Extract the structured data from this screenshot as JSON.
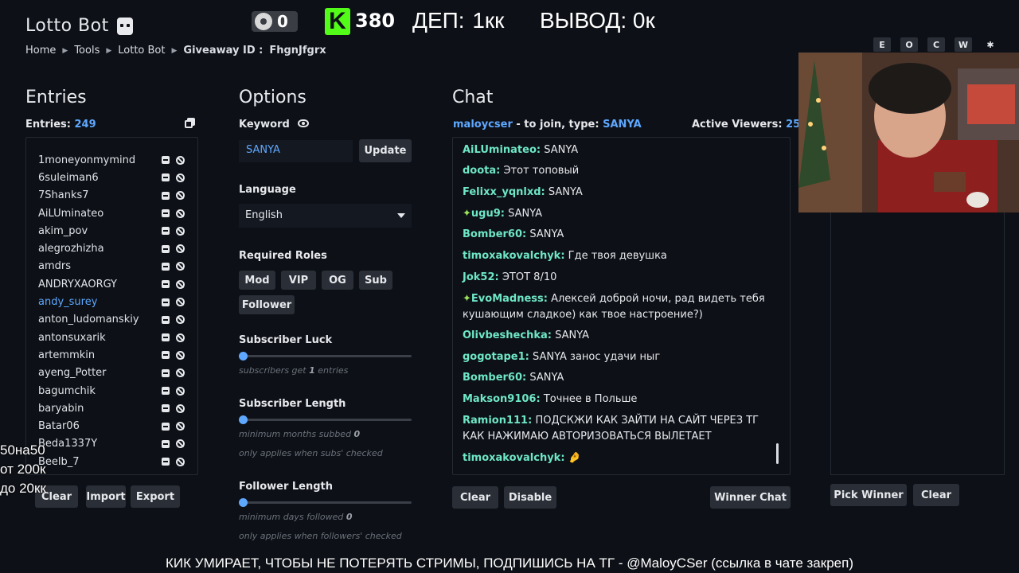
{
  "app": {
    "title": "Lotto Bot"
  },
  "breadcrumb": {
    "home": "Home",
    "tools": "Tools",
    "lotto": "Lotto Bot",
    "giveaway_label": "Giveaway ID :",
    "giveaway_id": "FhgnJfgrx"
  },
  "stream_overlay": {
    "viewer_count": "0",
    "kick_count": "380",
    "deposit": "ДЕП: 1кк",
    "withdraw": "ВЫВОД: 0к",
    "left_lines": [
      "50на50",
      "от 200к",
      "до 20кк"
    ],
    "ticker": "КИК УМИРАЕТ, ЧТОБЫ НЕ ПОТЕРЯТЬ СТРИМЫ, ПОДПИШИСЬ НА ТГ - @MaloyCSer (ссылка в чате закреп)"
  },
  "shortcut_keys": [
    "E",
    "O",
    "C",
    "W",
    "✱"
  ],
  "entries": {
    "title": "Entries",
    "count_label": "Entries:",
    "count": "249",
    "list": [
      {
        "name": "1moneyonmymind"
      },
      {
        "name": "6suleiman6"
      },
      {
        "name": "7Shanks7"
      },
      {
        "name": "AiLUminateo"
      },
      {
        "name": "akim_pov"
      },
      {
        "name": "alegrozhizha"
      },
      {
        "name": "amdrs"
      },
      {
        "name": "ANDRYXAORGY"
      },
      {
        "name": "andy_surey",
        "highlight": true
      },
      {
        "name": "anton_ludomanskiy"
      },
      {
        "name": "antonsuxarik"
      },
      {
        "name": "artemmkin"
      },
      {
        "name": "ayeng_Potter"
      },
      {
        "name": "bagumchik"
      },
      {
        "name": "baryabin"
      },
      {
        "name": "Batar06"
      },
      {
        "name": "Beda1337Y"
      },
      {
        "name": "Beelb_7"
      }
    ],
    "buttons": {
      "clear": "Clear",
      "import": "Import",
      "export": "Export"
    }
  },
  "options": {
    "title": "Options",
    "keyword_label": "Keyword",
    "keyword_value": "SANYA",
    "update": "Update",
    "language_label": "Language",
    "language_value": "English",
    "roles_label": "Required Roles",
    "roles": [
      "Mod",
      "VIP",
      "OG",
      "Sub",
      "Follower"
    ],
    "sub_luck": {
      "label": "Subscriber Luck",
      "hint_pre": "subscribers get",
      "hint_val": "1",
      "hint_post": "entries",
      "value": 0
    },
    "sub_length": {
      "label": "Subscriber Length",
      "hint_pre": "minimum months subbed",
      "hint_val": "0",
      "note": "only applies when subs' checked",
      "value": 0
    },
    "follower_length": {
      "label": "Follower Length",
      "hint_pre": "minimum days followed",
      "hint_val": "0",
      "note": "only applies when followers' checked",
      "value": 0
    }
  },
  "chat": {
    "title": "Chat",
    "streamer": "maloycser",
    "join_text": "- to join, type:",
    "keyword": "SANYA",
    "active_label": "Active Viewers:",
    "active_count": "259",
    "messages": [
      {
        "user": "AiLUminateo:",
        "text": "SANYA"
      },
      {
        "user": "doota:",
        "text": "Этот топовый"
      },
      {
        "user": "Felixx_yqnlxd:",
        "text": "SANYA"
      },
      {
        "user": "ugu9:",
        "text": "SANYA",
        "star": true
      },
      {
        "user": "Bomber60:",
        "text": "SANYA"
      },
      {
        "user": "timoxakovalchyk:",
        "text": "Где твоя девушка"
      },
      {
        "user": "Jok52:",
        "text": "ЭТОТ 8/10"
      },
      {
        "user": "EvoMadness:",
        "text": "Алексей доброй ночи, рад видеть тебя кушающим сладкое) как твое настроение?)",
        "star": true
      },
      {
        "user": "Olivbeshechka:",
        "text": "SANYA"
      },
      {
        "user": "gogotape1:",
        "text": "SANYA занос удачи ныг"
      },
      {
        "user": "Bomber60:",
        "text": "SANYA"
      },
      {
        "user": "Makson9106:",
        "text": "Точнее в Польше"
      },
      {
        "user": "Ramion111:",
        "text": "ПОДСКЖИ КАК ЗАЙТИ НА САЙТ ЧЕРЕЗ ТГ КАК НАЖИМАЮ АВТОРИЗОВАТЬСЯ ВЫЛЕТАЕТ"
      },
      {
        "user": "timoxakovalchyk:",
        "text": "🤌"
      }
    ],
    "buttons": {
      "clear": "Clear",
      "disable": "Disable",
      "winner_chat": "Winner Chat"
    }
  },
  "winner": {
    "pick": "Pick Winner",
    "clear": "Clear"
  },
  "colors": {
    "accent": "#5ea8ff",
    "chat_user": "#6ee7c6",
    "kick_green": "#53fc18",
    "background": "#0d1016"
  }
}
